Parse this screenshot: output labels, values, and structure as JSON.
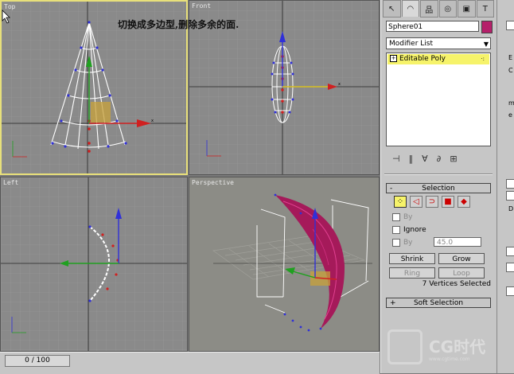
{
  "caption": "切换成多边型,删除多余的面.",
  "viewports": {
    "top": {
      "label": "Top"
    },
    "front": {
      "label": "Front"
    },
    "left": {
      "label": "Left"
    },
    "perspective": {
      "label": "Perspective"
    }
  },
  "timeline": {
    "value": "0 / 100"
  },
  "command_panel": {
    "tabs": [
      "create-tab",
      "modify-tab",
      "hierarchy-tab",
      "motion-tab",
      "display-tab",
      "utilities-tab"
    ],
    "object_name": "Sphere01",
    "object_color": "#b5206a",
    "modifier_list": "Modifier List",
    "stack_item": "Editable Poly"
  },
  "selection": {
    "title": "Selection",
    "by_vertex": "By",
    "ignore": "Ignore",
    "by_angle": "By",
    "angle_value": "45.0",
    "shrink": "Shrink",
    "grow": "Grow",
    "ring": "Ring",
    "loop": "Loop",
    "status": "7 Vertices Selected"
  },
  "soft_selection": {
    "title": "Soft Selection"
  },
  "right_strip": {
    "frag1": "E",
    "frag2": "C",
    "frag3": "m",
    "frag4": "e",
    "frag5": "D"
  },
  "watermark": {
    "text": "CG时代",
    "url": "www.cgtime.com"
  },
  "colors": {
    "accent_yellow": "#f6f36a",
    "active_border": "#e8e07a",
    "poly_pink": "#b5206a"
  }
}
